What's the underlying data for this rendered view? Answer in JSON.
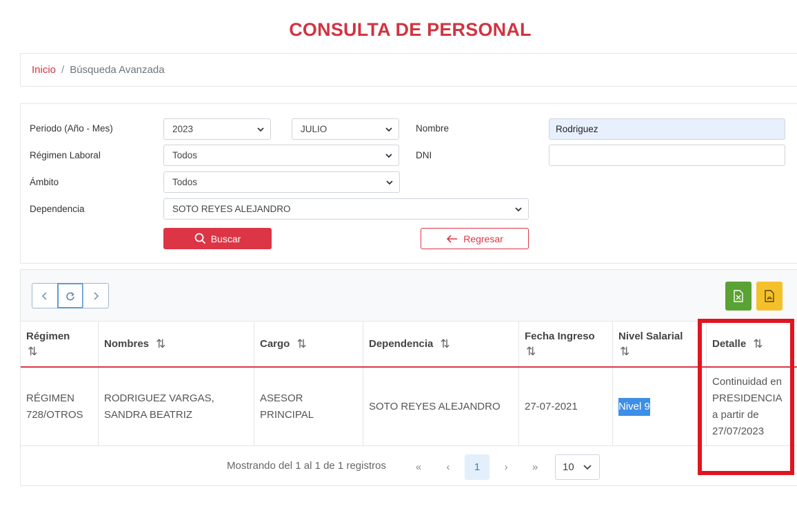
{
  "page": {
    "title": "CONSULTA DE PERSONAL"
  },
  "breadcrumb": {
    "home": "Inicio",
    "separator": "/",
    "current": "Búsqueda Avanzada"
  },
  "form": {
    "periodo_label": "Periodo (Año - Mes)",
    "year_value": "2023",
    "month_value": "JULIO",
    "nombre_label": "Nombre",
    "nombre_value": "Rodriguez",
    "regimen_label": "Régimen Laboral",
    "regimen_value": "Todos",
    "dni_label": "DNI",
    "dni_value": "",
    "ambito_label": "Ámbito",
    "ambito_value": "Todos",
    "dependencia_label": "Dependencia",
    "dependencia_value": "SOTO REYES ALEJANDRO",
    "buscar_label": "Buscar",
    "regresar_label": "Regresar"
  },
  "table": {
    "headers": [
      "Régimen",
      "Nombres",
      "Cargo",
      "Dependencia",
      "Fecha Ingreso",
      "Nivel Salarial",
      "Detalle"
    ],
    "sort_glyph": "⇅",
    "rows": [
      {
        "regimen": "RÉGIMEN 728/OTROS",
        "nombres": "RODRIGUEZ VARGAS, SANDRA BEATRIZ",
        "cargo": "ASESOR PRINCIPAL",
        "dependencia": "SOTO REYES ALEJANDRO",
        "fecha": "27-07-2021",
        "nivel": "Nivel 9",
        "detalle": "Continuidad en PRESIDENCIA a partir de 27/07/2023"
      }
    ]
  },
  "pagination": {
    "info": "Mostrando del 1 al 1 de 1 registros",
    "first": "«",
    "prev": "‹",
    "current_page": "1",
    "next": "›",
    "last": "»",
    "per_page": "10"
  },
  "colors": {
    "accent": "#dc3545",
    "title": "#d03441",
    "excel": "#5aa233",
    "pdf": "#f5c12b",
    "highlight": "#e1151f"
  },
  "icons": [
    "search-icon",
    "arrow-left-icon",
    "chevron-left-icon",
    "refresh-icon",
    "chevron-right-icon",
    "excel-file-icon",
    "pdf-file-icon",
    "sort-icon",
    "chevron-down-icon"
  ]
}
